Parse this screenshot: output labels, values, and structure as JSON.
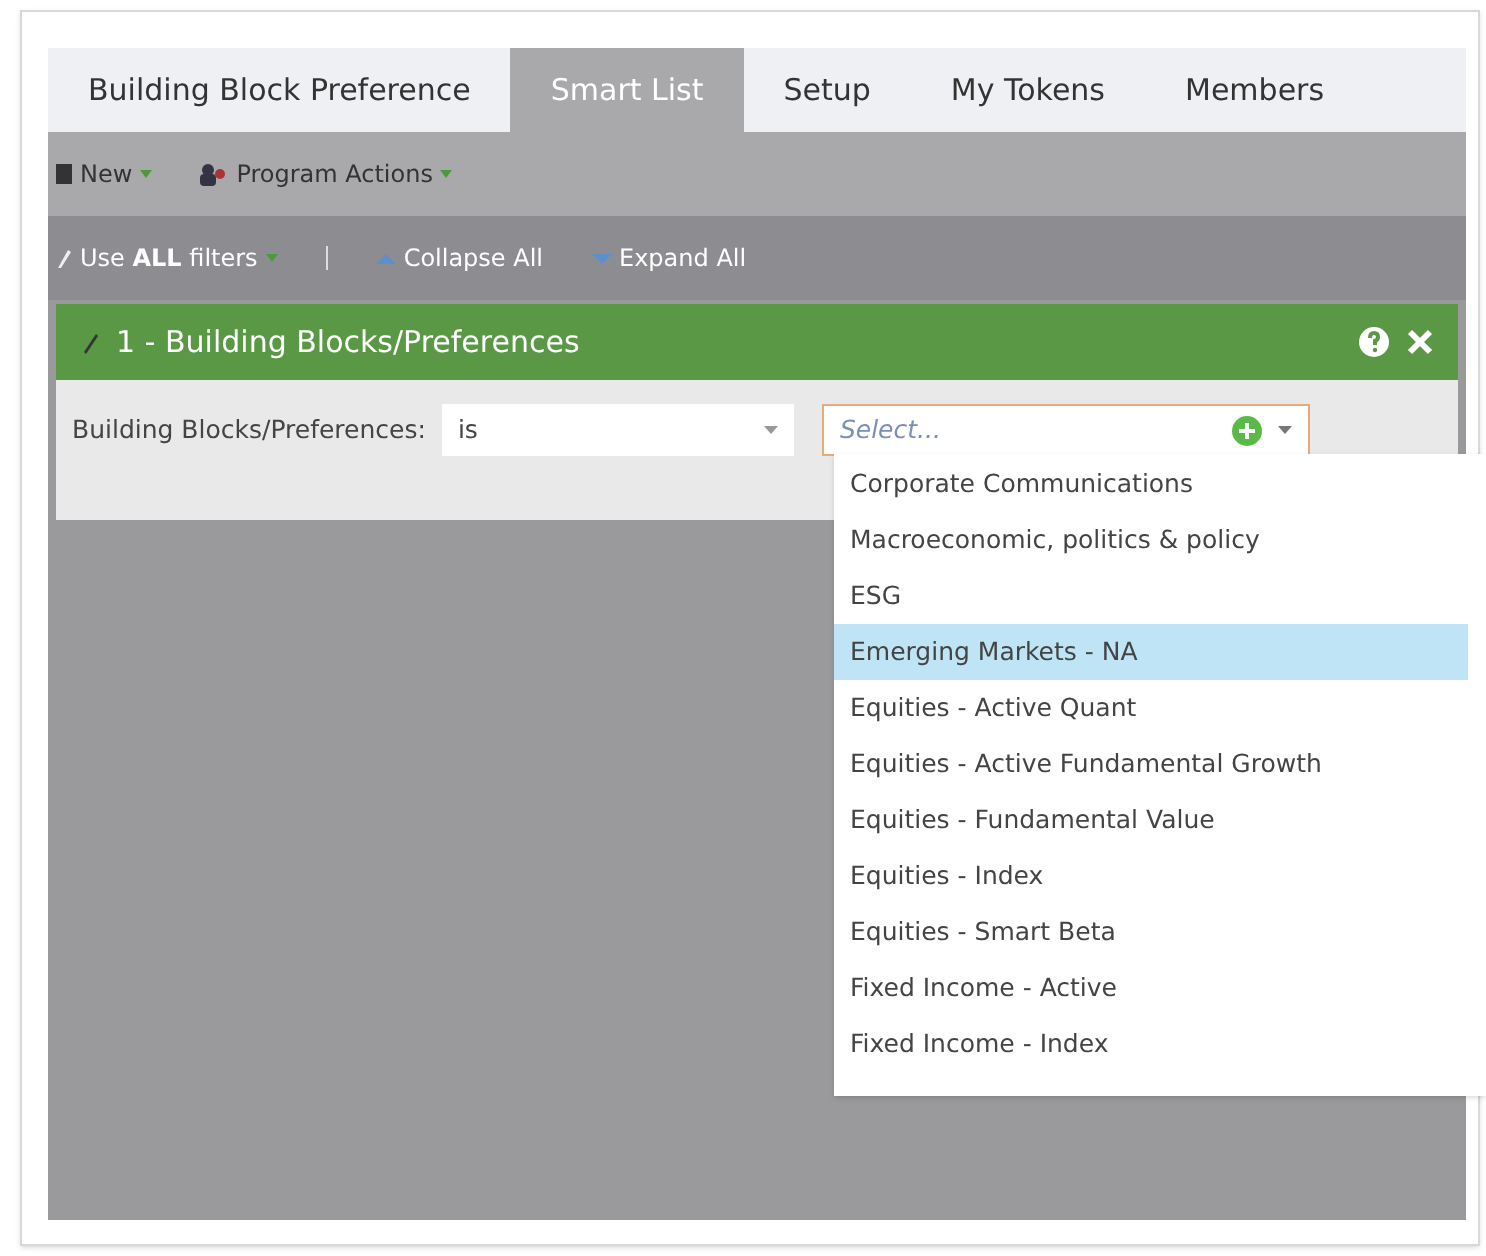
{
  "tabs": [
    {
      "label": "Building Block Preference",
      "selected": false
    },
    {
      "label": "Smart List",
      "selected": true
    },
    {
      "label": "Setup",
      "selected": false
    },
    {
      "label": "My Tokens",
      "selected": false
    },
    {
      "label": "Members",
      "selected": false
    }
  ],
  "toolbar": [
    {
      "label": "New"
    },
    {
      "label": "Program Actions"
    }
  ],
  "filter_bar": {
    "use_prefix": "Use ",
    "use_bold": "ALL",
    "use_suffix": " filters",
    "collapse": "Collapse All",
    "expand": "Expand All"
  },
  "filter": {
    "title": "1 - Building Blocks/Preferences",
    "label": "Building Blocks/Preferences:",
    "operator": "is",
    "placeholder": "Select..."
  },
  "options": [
    {
      "label": "Corporate Communications",
      "selected": false
    },
    {
      "label": "Macroeconomic, politics & policy",
      "selected": false
    },
    {
      "label": "ESG",
      "selected": false
    },
    {
      "label": "Emerging Markets - NA",
      "selected": true
    },
    {
      "label": "Equities - Active Quant",
      "selected": false
    },
    {
      "label": "Equities - Active Fundamental Growth",
      "selected": false
    },
    {
      "label": "Equities - Fundamental Value",
      "selected": false
    },
    {
      "label": "Equities - Index",
      "selected": false
    },
    {
      "label": "Equities - Smart Beta",
      "selected": false
    },
    {
      "label": "Fixed Income - Active",
      "selected": false
    },
    {
      "label": "Fixed Income - Index",
      "selected": false
    }
  ]
}
